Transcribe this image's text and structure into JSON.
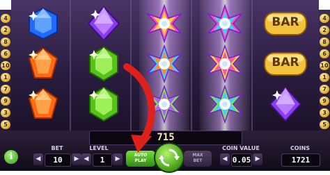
{
  "game": {
    "paylines_left": [
      "4",
      "2",
      "8",
      "6",
      "10",
      "1",
      "7",
      "9",
      "3",
      "5"
    ],
    "paylines_right": [
      "4",
      "2",
      "8",
      "6",
      "10",
      "1",
      "7",
      "9",
      "3",
      "5"
    ],
    "reels": [
      [
        "blue-gem",
        "orange-gem",
        "orange-gem"
      ],
      [
        "purple-gem",
        "green-gem",
        "green-gem"
      ],
      [
        "expanding-wild",
        "expanding-wild",
        "expanding-wild"
      ],
      [
        "expanding-wild",
        "expanding-wild",
        "expanding-wild"
      ],
      [
        "bar",
        "bar",
        "purple-gem"
      ]
    ],
    "bar_label": "BAR",
    "win_amount": "715",
    "labels": {
      "bet": "BET",
      "level": "LEVEL",
      "coin_value": "COIN VALUE",
      "coins": "COINS"
    },
    "values": {
      "bet": "10",
      "level": "1",
      "coin_value": "0.05",
      "coins": "1721"
    },
    "buttons": {
      "info": "i",
      "auto_play_line1": "AUTO",
      "auto_play_line2": "PLAY",
      "max_bet_line1": "MAX",
      "max_bet_line2": "BET"
    },
    "icons": {
      "spin": "circular-arrows-icon",
      "pointer": "red-curved-arrow-icon",
      "decrease": "chevron-left-icon",
      "increase": "chevron-right-icon"
    },
    "colors": {
      "blue_gem": "#1f6bff",
      "purple_gem": "#8a3df0",
      "orange_gem": "#ff6a12",
      "green_gem": "#57c21a",
      "bar_gold": "#f2c23a",
      "red_arrow": "#e0201a",
      "green_button": "#4fb91b"
    }
  }
}
